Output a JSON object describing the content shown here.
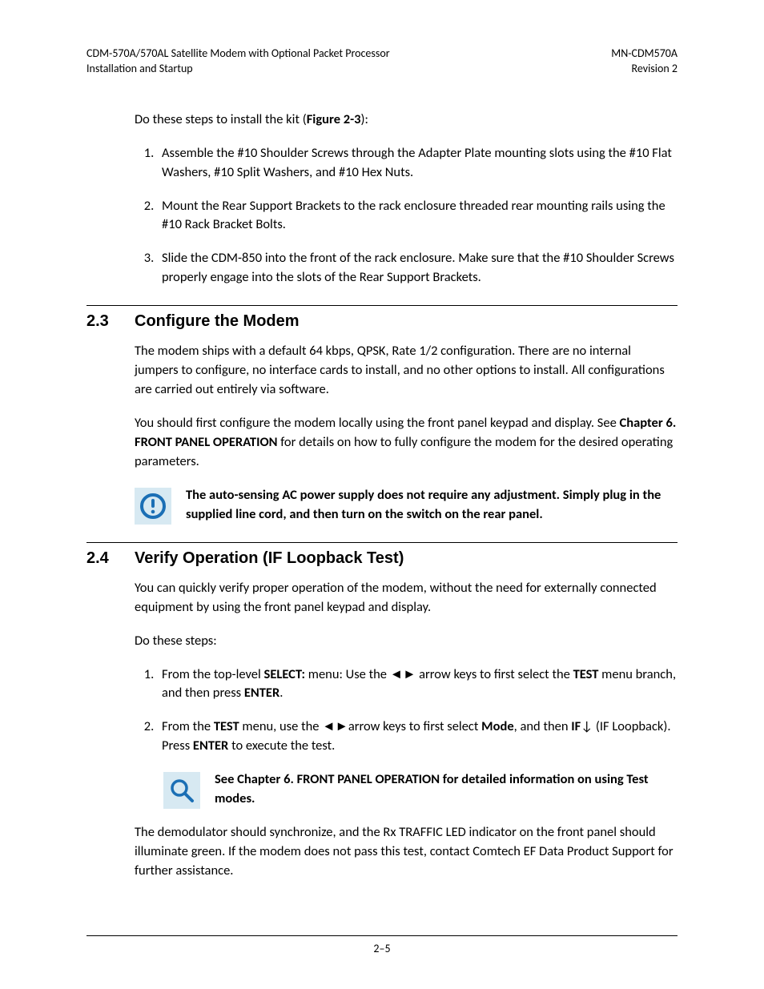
{
  "header": {
    "left_line1": "CDM-570A/570AL Satellite Modem with Optional Packet Processor",
    "left_line2": "Installation and Startup",
    "right_line1": "MN-CDM570A",
    "right_line2": "Revision 2"
  },
  "intro_para_prefix": "Do these steps to install the kit (",
  "intro_para_bold": "Figure 2-3",
  "intro_para_suffix": "):",
  "install_steps": {
    "s1": "Assemble the #10 Shoulder Screws through the Adapter Plate mounting slots using the #10 Flat Washers, #10 Split Washers, and #10 Hex Nuts.",
    "s2": "Mount the Rear Support Brackets to the rack enclosure threaded rear mounting rails using the #10 Rack Bracket Bolts.",
    "s3": "Slide the CDM-850 into the front of the rack enclosure. Make sure that the #10 Shoulder Screws properly engage into the slots of the Rear Support Brackets."
  },
  "sec23": {
    "num": "2.3",
    "title": "Configure the Modem",
    "p1": "The modem ships with a default 64 kbps, QPSK, Rate 1/2 configuration. There are no internal jumpers to configure, no interface cards to install, and no other options to install. All configurations are carried out entirely via software.",
    "p2_a": "You should first configure the modem locally using the front panel keypad and display. See ",
    "p2_bold": "Chapter 6. FRONT PANEL OPERATION",
    "p2_b": " for details on how to fully configure the modem for the desired operating parameters.",
    "note": "The auto-sensing AC power supply does not require any adjustment. Simply plug in the supplied line cord, and then turn on the switch on the rear panel."
  },
  "sec24": {
    "num": "2.4",
    "title": "Verify Operation (IF Loopback Test)",
    "p1": "You can quickly verify proper operation of the modem, without the need for externally connected equipment by using the front panel keypad and display.",
    "p2": "Do these steps:",
    "step1_a": "From the top-level ",
    "step1_b": "SELECT:",
    "step1_c": " menu: Use the ◄► arrow keys to first select the ",
    "step1_d": "TEST",
    "step1_e": " menu branch, and then press ",
    "step1_f": "ENTER",
    "step1_g": ".",
    "step2_a": "From the ",
    "step2_b": "TEST",
    "step2_c": " menu, use the ◄►arrow keys to first select ",
    "step2_d": "Mode",
    "step2_e": ", and then ",
    "step2_f": "IF",
    "step2_g": "↓ (IF Loopback). Press ",
    "step2_h": "ENTER",
    "step2_i": " to execute the test.",
    "note": "See Chapter 6. FRONT PANEL OPERATION for detailed information on using Test modes.",
    "p3": "The demodulator should synchronize, and the Rx TRAFFIC LED indicator on the front panel should illuminate green. If the modem does not pass this test, contact Comtech EF Data Product Support for further assistance."
  },
  "page_number": "2–5",
  "icons": {
    "alert": "alert-circle-icon",
    "search": "magnifier-icon"
  }
}
